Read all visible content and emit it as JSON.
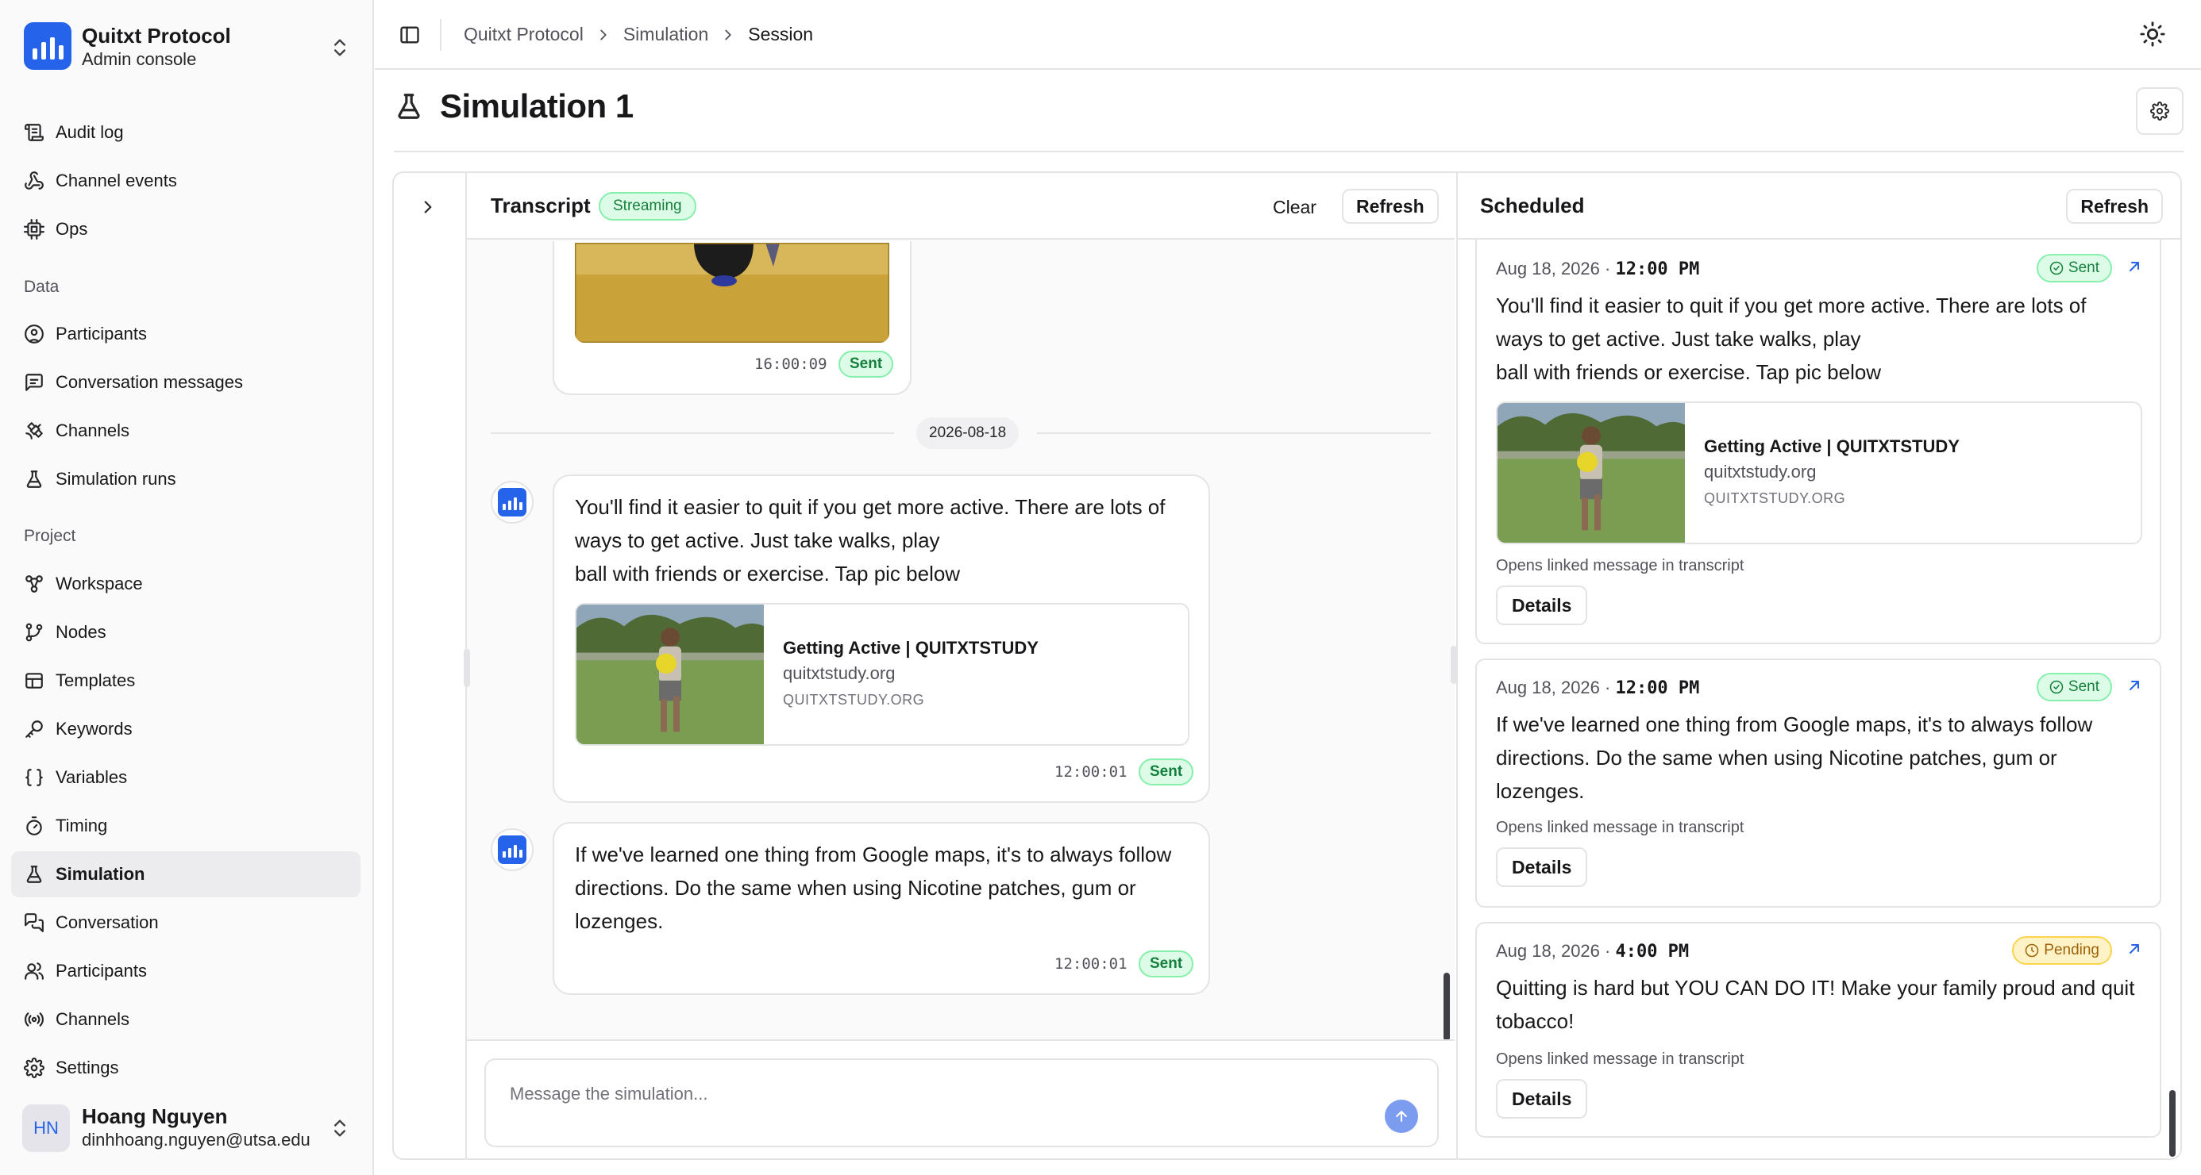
{
  "brand": {
    "name": "Quitxt Protocol",
    "subtitle": "Admin console"
  },
  "sidebar": {
    "top_items": [
      {
        "label": "Audit log",
        "icon": "scroll-icon"
      },
      {
        "label": "Channel events",
        "icon": "webhook-icon"
      },
      {
        "label": "Ops",
        "icon": "cpu-icon"
      }
    ],
    "group_data": "Data",
    "data_items": [
      {
        "label": "Participants",
        "icon": "user-circle-icon"
      },
      {
        "label": "Conversation messages",
        "icon": "message-square-icon"
      },
      {
        "label": "Channels",
        "icon": "satellite-icon"
      },
      {
        "label": "Simulation runs",
        "icon": "flask-icon"
      }
    ],
    "group_project": "Project",
    "project_items": [
      {
        "label": "Workspace",
        "icon": "workflow-icon"
      },
      {
        "label": "Nodes",
        "icon": "git-branch-icon"
      },
      {
        "label": "Templates",
        "icon": "table-icon"
      },
      {
        "label": "Keywords",
        "icon": "key-icon"
      },
      {
        "label": "Variables",
        "icon": "braces-icon"
      },
      {
        "label": "Timing",
        "icon": "timer-icon"
      },
      {
        "label": "Simulation",
        "icon": "flask-icon"
      },
      {
        "label": "Conversation",
        "icon": "messages-icon"
      },
      {
        "label": "Participants",
        "icon": "users-icon"
      },
      {
        "label": "Channels",
        "icon": "radio-icon"
      },
      {
        "label": "Settings",
        "icon": "gear-icon"
      }
    ],
    "active": "Simulation"
  },
  "user": {
    "initials": "HN",
    "name": "Hoang Nguyen",
    "email": "dinhhoang.nguyen@utsa.edu"
  },
  "breadcrumbs": [
    "Quitxt Protocol",
    "Simulation",
    "Session"
  ],
  "page": {
    "title": "Simulation 1"
  },
  "transcript": {
    "title": "Transcript",
    "status": "Streaming",
    "clear_label": "Clear",
    "refresh_label": "Refresh",
    "date_divider": "2026-08-18",
    "messages": [
      {
        "time": "16:00:09",
        "status": "Sent"
      },
      {
        "lines": [
          "You'll find it easier to quit if you get more active. There are lots of",
          "ways to get active. Just take walks, play",
          "ball with friends or exercise. Tap pic below"
        ],
        "card": {
          "title": "Getting Active | QUITXTSTUDY",
          "domain": "quitxtstudy.org",
          "upper": "QUITXTSTUDY.ORG"
        },
        "time": "12:00:01",
        "status": "Sent"
      },
      {
        "lines": [
          "If we've learned one thing from Google maps, it's to always follow",
          "directions. Do the same when using Nicotine patches, gum or",
          "lozenges."
        ],
        "time": "12:00:01",
        "status": "Sent"
      }
    ],
    "composer_placeholder": "Message the simulation..."
  },
  "scheduled": {
    "title": "Scheduled",
    "refresh_label": "Refresh",
    "items": [
      {
        "date": "Aug 18, 2026 · ",
        "time": "12:00 PM",
        "status": "Sent",
        "lines": [
          "You'll find it easier to quit if you get more active. There are lots of",
          "ways to get active. Just take walks, play",
          "ball with friends or exercise. Tap pic below"
        ],
        "card": {
          "title": "Getting Active | QUITXTSTUDY",
          "domain": "quitxtstudy.org",
          "upper": "QUITXTSTUDY.ORG"
        },
        "note": "Opens linked message in transcript",
        "details_label": "Details"
      },
      {
        "date": "Aug 18, 2026 · ",
        "time": "12:00 PM",
        "status": "Sent",
        "lines": [
          "If we've learned one thing from Google maps, it's to always follow",
          "directions. Do the same when using Nicotine patches, gum or",
          "lozenges."
        ],
        "note": "Opens linked message in transcript",
        "details_label": "Details"
      },
      {
        "date": "Aug 18, 2026 · ",
        "time": "4:00 PM",
        "status": "Pending",
        "lines": [
          "Quitting is hard but YOU CAN DO IT! Make your family proud and quit",
          "tobacco!"
        ],
        "note": "Opens linked message in transcript",
        "details_label": "Details"
      }
    ]
  },
  "colors": {
    "accent": "#2563eb",
    "sent_bg": "#dcfce7",
    "sent_fg": "#15803d",
    "pending_bg": "#fef3c7",
    "pending_fg": "#a16207"
  }
}
